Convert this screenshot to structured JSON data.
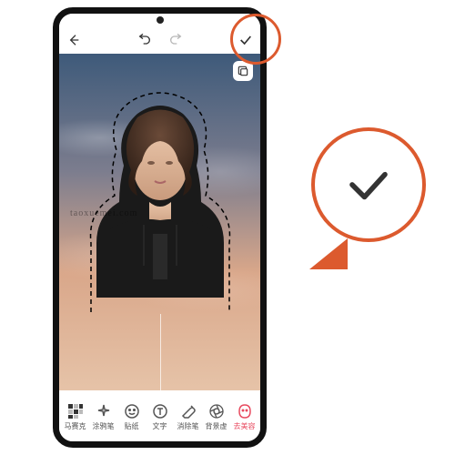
{
  "watermark": "taoxuemei.com",
  "toolbar": {
    "items": [
      {
        "label": "马赛克"
      },
      {
        "label": "涂鸦笔"
      },
      {
        "label": "贴纸"
      },
      {
        "label": "文字"
      },
      {
        "label": "消除笔"
      },
      {
        "label": "背景虚"
      },
      {
        "label": "去美容"
      }
    ],
    "activeIndex": 6
  },
  "icons": {
    "back": "back-icon",
    "undo": "undo-icon",
    "redo": "redo-icon",
    "confirm": "check-icon",
    "compare": "compare-icon"
  },
  "colors": {
    "accent": "#e84a5f",
    "highlight": "#dc5a2e"
  }
}
